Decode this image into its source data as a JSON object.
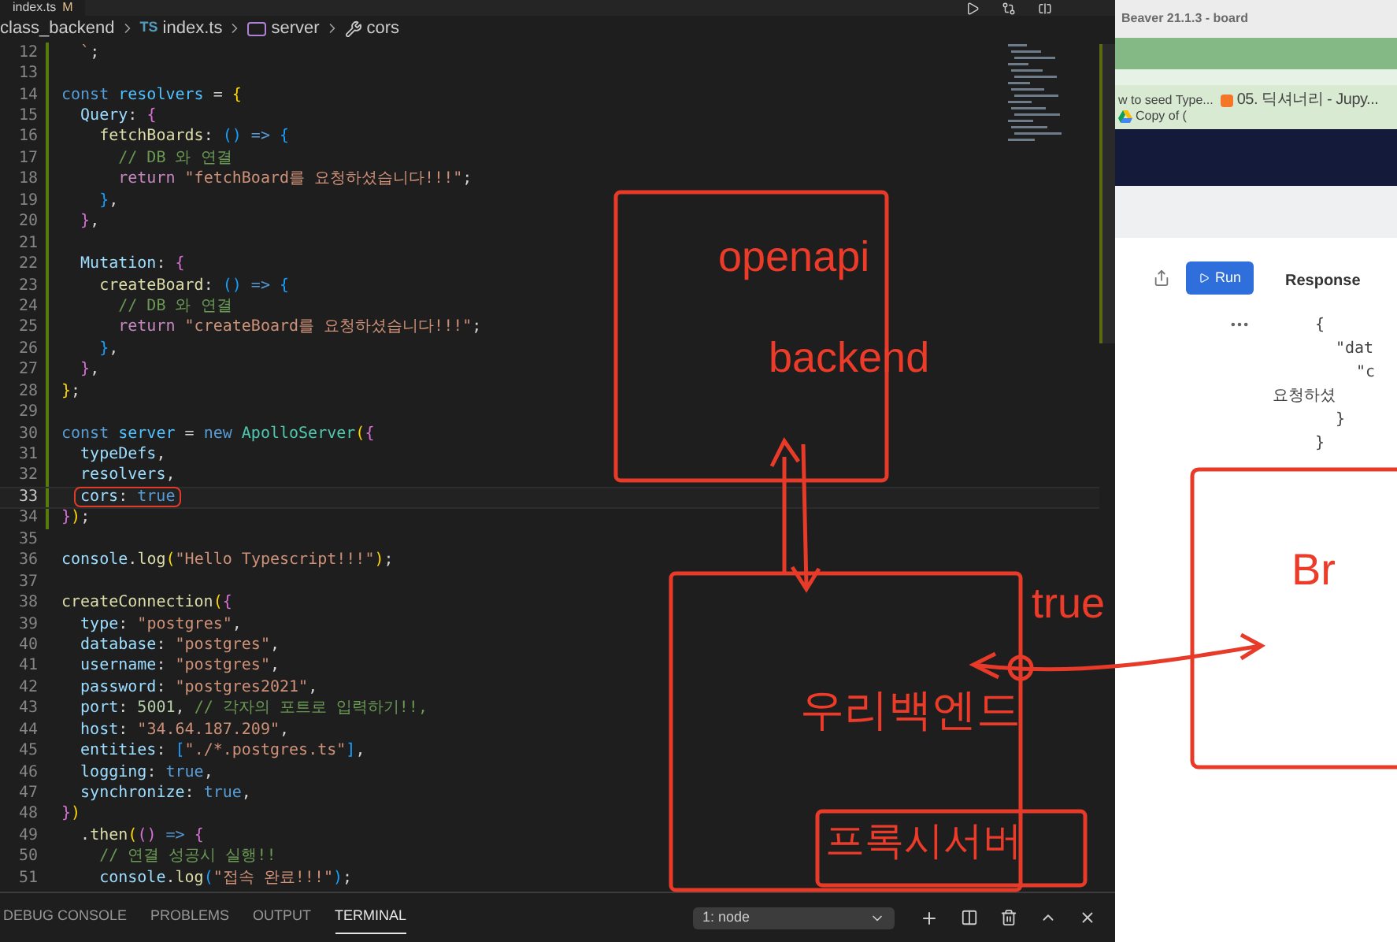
{
  "editor": {
    "tab": {
      "label": "index.ts",
      "badge": "M"
    },
    "breadcrumbs": [
      {
        "text": "class_backend",
        "kind": "folder"
      },
      {
        "text": "index.ts",
        "kind": "file",
        "prefix": "TS"
      },
      {
        "text": "server",
        "kind": "variable"
      },
      {
        "text": "cors",
        "kind": "property"
      }
    ],
    "lines": [
      {
        "number": "12",
        "current": false,
        "tokens": [
          {
            "t": "  `",
            "kind": "str"
          },
          {
            "t": ";",
            "kind": "p"
          }
        ]
      },
      {
        "number": "13",
        "current": false
      },
      {
        "number": "14",
        "current": false,
        "tokens": [
          {
            "t": "const ",
            "kind": "kw"
          },
          {
            "t": "resolvers",
            "kind": "var"
          },
          {
            "t": " = ",
            "kind": "p"
          },
          {
            "t": "{",
            "kind": "b1"
          }
        ]
      },
      {
        "number": "15",
        "current": false,
        "tokens": [
          {
            "t": "  Query",
            "kind": "prop"
          },
          {
            "t": ": ",
            "kind": "p"
          },
          {
            "t": "{",
            "kind": "b2"
          }
        ]
      },
      {
        "number": "16",
        "current": false,
        "tokens": [
          {
            "t": "    fetchBoards",
            "kind": "fn"
          },
          {
            "t": ": ",
            "kind": "p"
          },
          {
            "t": "()",
            "kind": "b3"
          },
          {
            "t": " => ",
            "kind": "kw"
          },
          {
            "t": "{",
            "kind": "b3"
          }
        ]
      },
      {
        "number": "17",
        "current": false,
        "tokens": [
          {
            "t": "      // DB 와 연결",
            "kind": "cm"
          }
        ]
      },
      {
        "number": "18",
        "current": false,
        "tokens": [
          {
            "t": "      return ",
            "kind": "kw2"
          },
          {
            "t": "\"fetchBoard를 요청하셨습니다!!!\"",
            "kind": "str"
          },
          {
            "t": ";",
            "kind": "p"
          }
        ]
      },
      {
        "number": "19",
        "current": false,
        "tokens": [
          {
            "t": "    }",
            "kind": "b3"
          },
          {
            "t": ",",
            "kind": "p"
          }
        ]
      },
      {
        "number": "20",
        "current": false,
        "tokens": [
          {
            "t": "  }",
            "kind": "b2"
          },
          {
            "t": ",",
            "kind": "p"
          }
        ]
      },
      {
        "number": "21",
        "current": false
      },
      {
        "number": "22",
        "current": false,
        "tokens": [
          {
            "t": "  Mutation",
            "kind": "prop"
          },
          {
            "t": ": ",
            "kind": "p"
          },
          {
            "t": "{",
            "kind": "b2"
          }
        ]
      },
      {
        "number": "23",
        "current": false,
        "tokens": [
          {
            "t": "    createBoard",
            "kind": "fn"
          },
          {
            "t": ": ",
            "kind": "p"
          },
          {
            "t": "()",
            "kind": "b3"
          },
          {
            "t": " => ",
            "kind": "kw"
          },
          {
            "t": "{",
            "kind": "b3"
          }
        ]
      },
      {
        "number": "24",
        "current": false,
        "tokens": [
          {
            "t": "      // DB 와 연결",
            "kind": "cm"
          }
        ]
      },
      {
        "number": "25",
        "current": false,
        "tokens": [
          {
            "t": "      return ",
            "kind": "kw2"
          },
          {
            "t": "\"createBoard를 요청하셨습니다!!!\"",
            "kind": "str"
          },
          {
            "t": ";",
            "kind": "p"
          }
        ]
      },
      {
        "number": "26",
        "current": false,
        "tokens": [
          {
            "t": "    }",
            "kind": "b3"
          },
          {
            "t": ",",
            "kind": "p"
          }
        ]
      },
      {
        "number": "27",
        "current": false,
        "tokens": [
          {
            "t": "  }",
            "kind": "b2"
          },
          {
            "t": ",",
            "kind": "p"
          }
        ]
      },
      {
        "number": "28",
        "current": false,
        "tokens": [
          {
            "t": "}",
            "kind": "b1"
          },
          {
            "t": ";",
            "kind": "p"
          }
        ]
      },
      {
        "number": "29",
        "current": false
      },
      {
        "number": "30",
        "current": false,
        "tokens": [
          {
            "t": "const ",
            "kind": "kw"
          },
          {
            "t": "server",
            "kind": "var"
          },
          {
            "t": " = ",
            "kind": "p"
          },
          {
            "t": "new ",
            "kind": "kw"
          },
          {
            "t": "ApolloServer",
            "kind": "cls"
          },
          {
            "t": "(",
            "kind": "b1"
          },
          {
            "t": "{",
            "kind": "b2"
          }
        ]
      },
      {
        "number": "31",
        "current": false,
        "tokens": [
          {
            "t": "  typeDefs",
            "kind": "prop"
          },
          {
            "t": ",",
            "kind": "p"
          }
        ]
      },
      {
        "number": "32",
        "current": false,
        "tokens": [
          {
            "t": "  resolvers",
            "kind": "prop"
          },
          {
            "t": ",",
            "kind": "p"
          }
        ]
      },
      {
        "number": "33",
        "current": true,
        "tokens": [
          {
            "t": "  cors",
            "kind": "prop"
          },
          {
            "t": ": ",
            "kind": "p"
          },
          {
            "t": "true",
            "kind": "kw"
          }
        ]
      },
      {
        "number": "34",
        "current": false,
        "tokens": [
          {
            "t": "}",
            "kind": "b2"
          },
          {
            "t": ")",
            "kind": "b1"
          },
          {
            "t": ";",
            "kind": "p"
          }
        ]
      },
      {
        "number": "35",
        "current": false
      },
      {
        "number": "36",
        "current": false,
        "tokens": [
          {
            "t": "console",
            "kind": "prop"
          },
          {
            "t": ".",
            "kind": "p"
          },
          {
            "t": "log",
            "kind": "fn"
          },
          {
            "t": "(",
            "kind": "b1"
          },
          {
            "t": "\"Hello Typescript!!!\"",
            "kind": "str"
          },
          {
            "t": ")",
            "kind": "b1"
          },
          {
            "t": ";",
            "kind": "p"
          }
        ]
      },
      {
        "number": "37",
        "current": false
      },
      {
        "number": "38",
        "current": false,
        "tokens": [
          {
            "t": "createConnection",
            "kind": "fn"
          },
          {
            "t": "(",
            "kind": "b1"
          },
          {
            "t": "{",
            "kind": "b2"
          }
        ]
      },
      {
        "number": "39",
        "current": false,
        "tokens": [
          {
            "t": "  type",
            "kind": "prop"
          },
          {
            "t": ": ",
            "kind": "p"
          },
          {
            "t": "\"postgres\"",
            "kind": "str"
          },
          {
            "t": ",",
            "kind": "p"
          }
        ]
      },
      {
        "number": "40",
        "current": false,
        "tokens": [
          {
            "t": "  database",
            "kind": "prop"
          },
          {
            "t": ": ",
            "kind": "p"
          },
          {
            "t": "\"postgres\"",
            "kind": "str"
          },
          {
            "t": ",",
            "kind": "p"
          }
        ]
      },
      {
        "number": "41",
        "current": false,
        "tokens": [
          {
            "t": "  username",
            "kind": "prop"
          },
          {
            "t": ": ",
            "kind": "p"
          },
          {
            "t": "\"postgres\"",
            "kind": "str"
          },
          {
            "t": ",",
            "kind": "p"
          }
        ]
      },
      {
        "number": "42",
        "current": false,
        "tokens": [
          {
            "t": "  password",
            "kind": "prop"
          },
          {
            "t": ": ",
            "kind": "p"
          },
          {
            "t": "\"postgres2021\"",
            "kind": "str"
          },
          {
            "t": ",",
            "kind": "p"
          }
        ]
      },
      {
        "number": "43",
        "current": false,
        "tokens": [
          {
            "t": "  port",
            "kind": "prop"
          },
          {
            "t": ": ",
            "kind": "p"
          },
          {
            "t": "5001",
            "kind": "num"
          },
          {
            "t": ", ",
            "kind": "p"
          },
          {
            "t": "// 각자의 포트로 입력하기!!,",
            "kind": "cm"
          }
        ]
      },
      {
        "number": "44",
        "current": false,
        "tokens": [
          {
            "t": "  host",
            "kind": "prop"
          },
          {
            "t": ": ",
            "kind": "p"
          },
          {
            "t": "\"34.64.187.209\"",
            "kind": "str"
          },
          {
            "t": ",",
            "kind": "p"
          }
        ]
      },
      {
        "number": "45",
        "current": false,
        "tokens": [
          {
            "t": "  entities",
            "kind": "prop"
          },
          {
            "t": ": ",
            "kind": "p"
          },
          {
            "t": "[",
            "kind": "b3"
          },
          {
            "t": "\"./*.postgres.ts\"",
            "kind": "str"
          },
          {
            "t": "]",
            "kind": "b3"
          },
          {
            "t": ",",
            "kind": "p"
          }
        ]
      },
      {
        "number": "46",
        "current": false,
        "tokens": [
          {
            "t": "  logging",
            "kind": "prop"
          },
          {
            "t": ": ",
            "kind": "p"
          },
          {
            "t": "true",
            "kind": "kw"
          },
          {
            "t": ",",
            "kind": "p"
          }
        ]
      },
      {
        "number": "47",
        "current": false,
        "tokens": [
          {
            "t": "  synchronize",
            "kind": "prop"
          },
          {
            "t": ": ",
            "kind": "p"
          },
          {
            "t": "true",
            "kind": "kw"
          },
          {
            "t": ",",
            "kind": "p"
          }
        ]
      },
      {
        "number": "48",
        "current": false,
        "tokens": [
          {
            "t": "}",
            "kind": "b2"
          },
          {
            "t": ")",
            "kind": "b1"
          }
        ]
      },
      {
        "number": "49",
        "current": false,
        "tokens": [
          {
            "t": "  .",
            "kind": "p"
          },
          {
            "t": "then",
            "kind": "fn"
          },
          {
            "t": "(",
            "kind": "b1"
          },
          {
            "t": "()",
            "kind": "b2"
          },
          {
            "t": " => ",
            "kind": "kw"
          },
          {
            "t": "{",
            "kind": "b2"
          }
        ]
      },
      {
        "number": "50",
        "current": false,
        "tokens": [
          {
            "t": "    // 연결 성공시 실행!!",
            "kind": "cm"
          }
        ]
      },
      {
        "number": "51",
        "current": false,
        "tokens": [
          {
            "t": "    console",
            "kind": "prop"
          },
          {
            "t": ".",
            "kind": "p"
          },
          {
            "t": "log",
            "kind": "fn"
          },
          {
            "t": "(",
            "kind": "b3"
          },
          {
            "t": "\"접속 완료!!!\"",
            "kind": "str"
          },
          {
            "t": ")",
            "kind": "b3"
          },
          {
            "t": ";",
            "kind": "p"
          }
        ]
      }
    ]
  },
  "panel": {
    "tabs": [
      {
        "label": "DEBUG CONSOLE",
        "selected": false
      },
      {
        "label": "PROBLEMS",
        "selected": false
      },
      {
        "label": "OUTPUT",
        "selected": false
      },
      {
        "label": "TERMINAL",
        "selected": true
      }
    ],
    "terminal_select": "1: node"
  },
  "browser": {
    "title": "Beaver 21.1.3 - board",
    "bookmarks": [
      {
        "label": "w to seed Type...",
        "kind": "none"
      },
      {
        "label": "05. 딕셔너리 - Jupy...",
        "kind": "notebook"
      },
      {
        "label": "Copy of (",
        "kind": "drive"
      }
    ],
    "run_button": "Run",
    "response_label": "Response",
    "response_lines": [
      {
        "text": "{",
        "kind": "brace"
      },
      {
        "text": "\"dat",
        "kind": "key"
      },
      {
        "text": "\"c",
        "kind": "key2"
      },
      {
        "text": "요청하셨",
        "kind": "wrap"
      },
      {
        "text": "}",
        "kind": "close"
      },
      {
        "text": "}",
        "kind": "brace"
      }
    ]
  },
  "annotations": [
    {
      "text": "openapi"
    },
    {
      "text": "backend"
    },
    {
      "text": "true"
    },
    {
      "text": "Br"
    },
    {
      "text": "우리백엔드"
    },
    {
      "text": "프록시서버"
    }
  ]
}
